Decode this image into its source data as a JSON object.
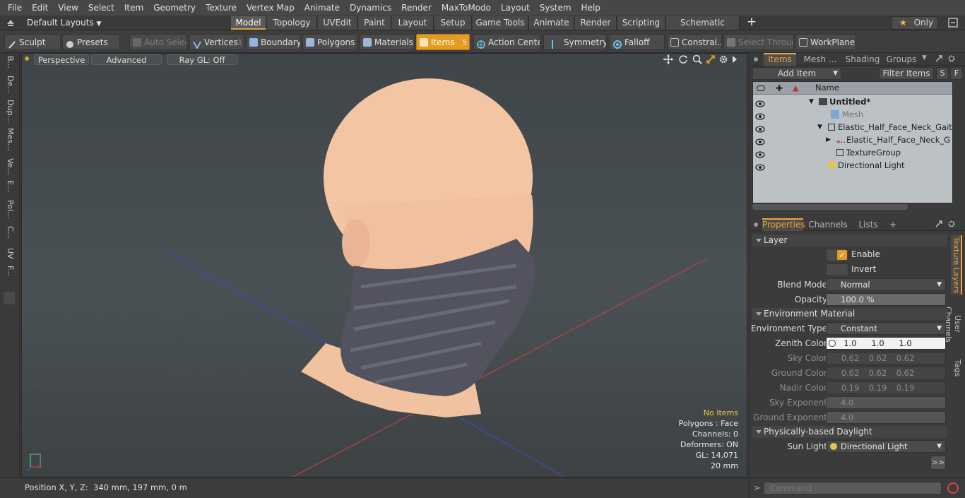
{
  "menubar": [
    "File",
    "Edit",
    "View",
    "Select",
    "Item",
    "Geometry",
    "Texture",
    "Vertex Map",
    "Animate",
    "Dynamics",
    "Render",
    "MaxToModo",
    "Layout",
    "System",
    "Help"
  ],
  "layoutbar": {
    "layout_dropdown": "Default Layouts",
    "tabs": [
      "Model",
      "Topology",
      "UVEdit",
      "Paint",
      "Layout",
      "Setup",
      "Game Tools",
      "Animate",
      "Render",
      "Scripting",
      "Schematic Fusion"
    ],
    "add": "+",
    "only_label": "Only"
  },
  "toolbar": {
    "sculpt": "Sculpt",
    "presets": "Presets",
    "auto_select": "Auto Select",
    "vertices": "Vertices",
    "vertices_count": "1",
    "boundary": "Boundary",
    "polygons": "Polygons",
    "materials": "Materials",
    "items": "Items",
    "items_count": "5",
    "action_center": "Action Center",
    "symmetry": "Symmetry",
    "falloff": "Falloff",
    "constraints": "Constrai...",
    "select_through": "Select Through",
    "workplane": "WorkPlane"
  },
  "leftstrip": [
    "B...",
    "De...",
    "Dup...",
    "Mes...",
    "Ve...",
    "E...",
    "Pol...",
    "C...",
    "UV",
    "F..."
  ],
  "viewport": {
    "view_mode": "Perspective",
    "shading": "Advanced",
    "raygl": "Ray GL: Off",
    "info": {
      "selection": "No Items",
      "polygons": "Polygons : Face",
      "channels": "Channels: 0",
      "deformers": "Deformers: ON",
      "gl": "GL: 14,071",
      "grid": "20 mm"
    }
  },
  "statusbar": {
    "position": "Position X, Y, Z:  340 mm, 197 mm, 0 m"
  },
  "items_panel": {
    "tabs": [
      "Items",
      "Mesh ...",
      "Shading",
      "Groups"
    ],
    "add_item": "Add Item",
    "filter_items": "Filter Items",
    "s_btn": "S",
    "f_btn": "F",
    "name_header": "Name",
    "tree": [
      {
        "label": "Untitled*",
        "kind": "scene"
      },
      {
        "label": "Mesh",
        "kind": "mesh"
      },
      {
        "label": "Elastic_Half_Face_Neck_Gait ...",
        "kind": "group"
      },
      {
        "label": "Elastic_Half_Face_Neck_G ...",
        "kind": "locator"
      },
      {
        "label": "TextureGroup",
        "kind": "texgroup"
      },
      {
        "label": "Directional Light",
        "kind": "light"
      }
    ]
  },
  "properties_panel": {
    "tabs": [
      "Properties",
      "Channels",
      "Lists"
    ],
    "add": "+",
    "side_tabs": [
      "Texture Layers",
      "User Channels",
      "Tags"
    ],
    "layer_section": "Layer",
    "enable": "Enable",
    "invert": "Invert",
    "blend_mode_label": "Blend Mode",
    "blend_mode": "Normal",
    "opacity_label": "Opacity",
    "opacity": "100.0 %",
    "env_section": "Environment Material",
    "env_type_label": "Environment Type",
    "env_type": "Constant",
    "zenith_label": "Zenith Color",
    "zenith": [
      "1.0",
      "1.0",
      "1.0"
    ],
    "sky_label": "Sky Color",
    "sky": [
      "0.62",
      "0.62",
      "0.62"
    ],
    "ground_label": "Ground Color",
    "ground": [
      "0.62",
      "0.62",
      "0.62"
    ],
    "nadir_label": "Nadir Color",
    "nadir": [
      "0.19",
      "0.19",
      "0.19"
    ],
    "sky_exp_label": "Sky Exponent",
    "sky_exp": "4.0",
    "ground_exp_label": "Ground Exponent",
    "ground_exp": "4.0",
    "daylight_section": "Physically-based Daylight",
    "sun_light_label": "Sun Light",
    "sun_light": "Directional Light",
    "more": ">>"
  },
  "command": {
    "prompt": ">",
    "placeholder": "Command"
  },
  "colors": {
    "accent": "#e49b22",
    "skin": "#f2c4a3",
    "mask": "#5a5a68"
  }
}
